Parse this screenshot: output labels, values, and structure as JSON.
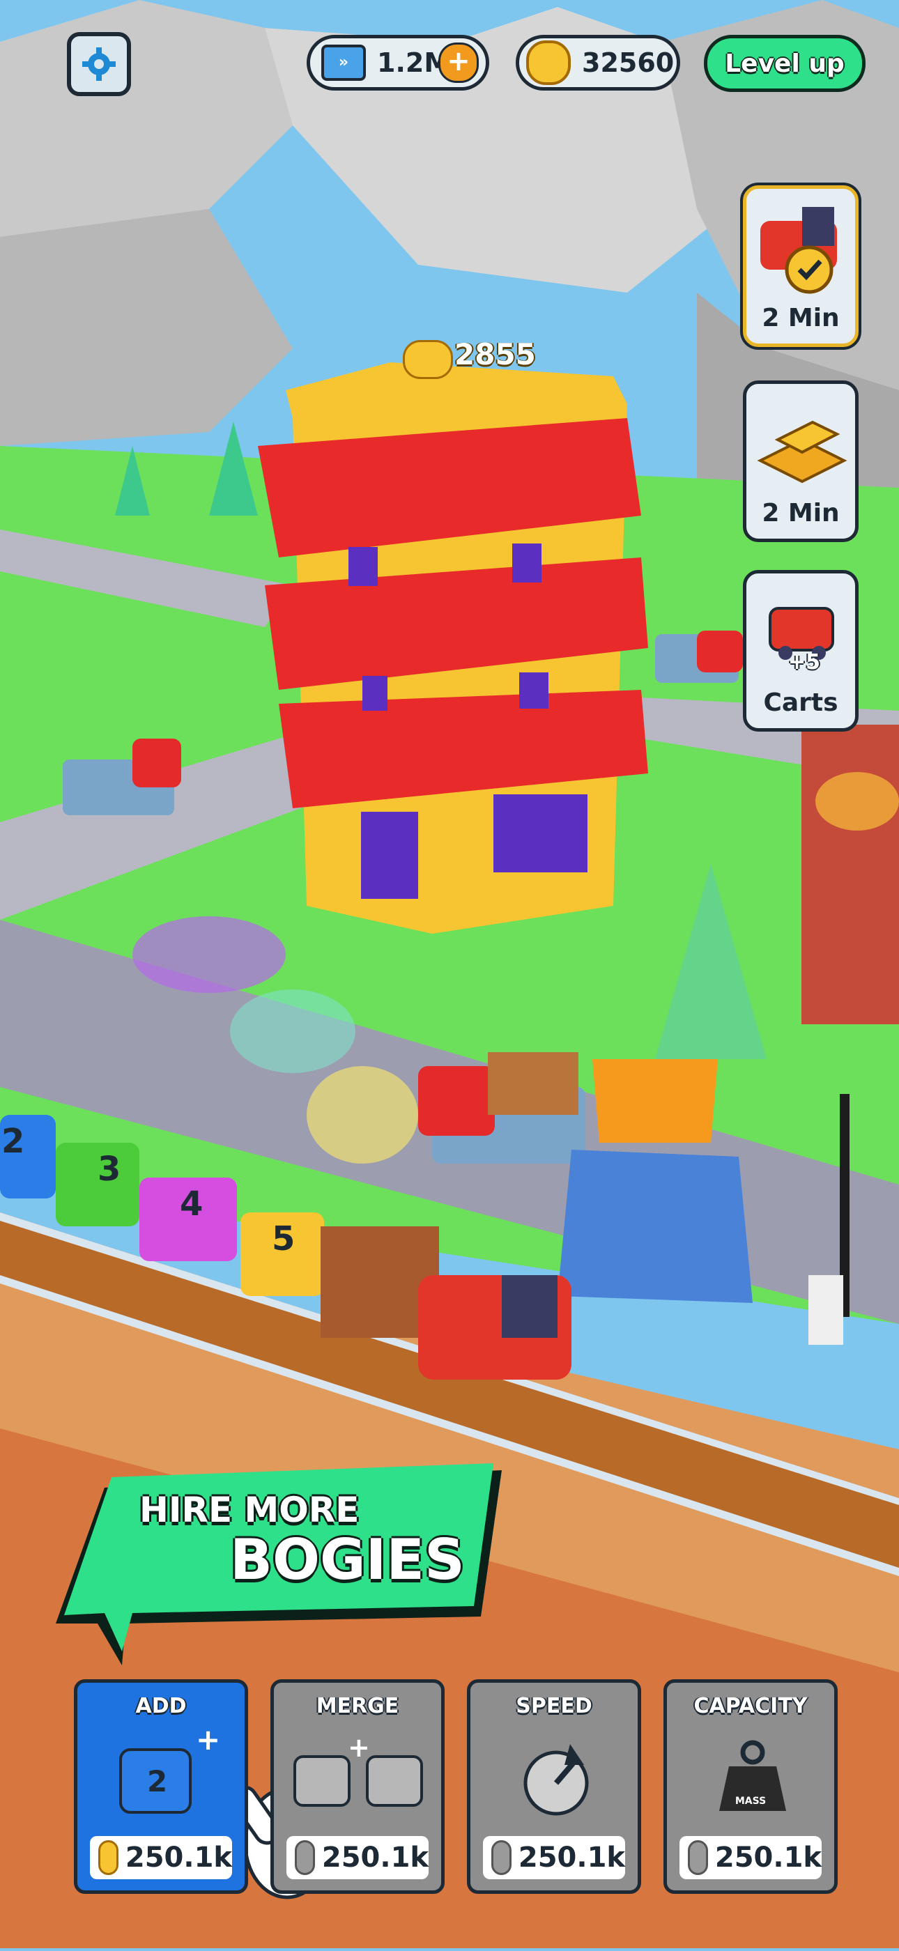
{
  "hud": {
    "tickets_value": "1.2M",
    "coins_value": "32560",
    "level_up_label": "Level up"
  },
  "side_panel": [
    {
      "label": "2 Min",
      "icon": "train-speed-boost-icon"
    },
    {
      "label": "2 Min",
      "icon": "gold-bars-icon"
    },
    {
      "label": "Carts",
      "icon": "plus-5-carts-icon",
      "badge": "+5"
    }
  ],
  "building": {
    "coin_reward": "2855"
  },
  "train": {
    "bogie_numbers": [
      "2",
      "3",
      "4",
      "5"
    ]
  },
  "banner": {
    "line1": "HIRE MORE",
    "line2": "BOGIES"
  },
  "upgrades": [
    {
      "title": "ADD",
      "price": "250.1k",
      "active": true
    },
    {
      "title": "MERGE",
      "price": "250.1k",
      "active": false
    },
    {
      "title": "SPEED",
      "price": "250.1k",
      "active": false
    },
    {
      "title": "CAPACITY",
      "price": "250.1k",
      "active": false,
      "weight_label": "MASS"
    }
  ],
  "colors": {
    "accent_green": "#2ee08a",
    "active_card_blue": "#1f73e0",
    "inactive_card_gray": "#8e8e8e",
    "tower_yellow": "#f7c531",
    "tower_red": "#e82a2a",
    "grass": "#6ce05a"
  }
}
